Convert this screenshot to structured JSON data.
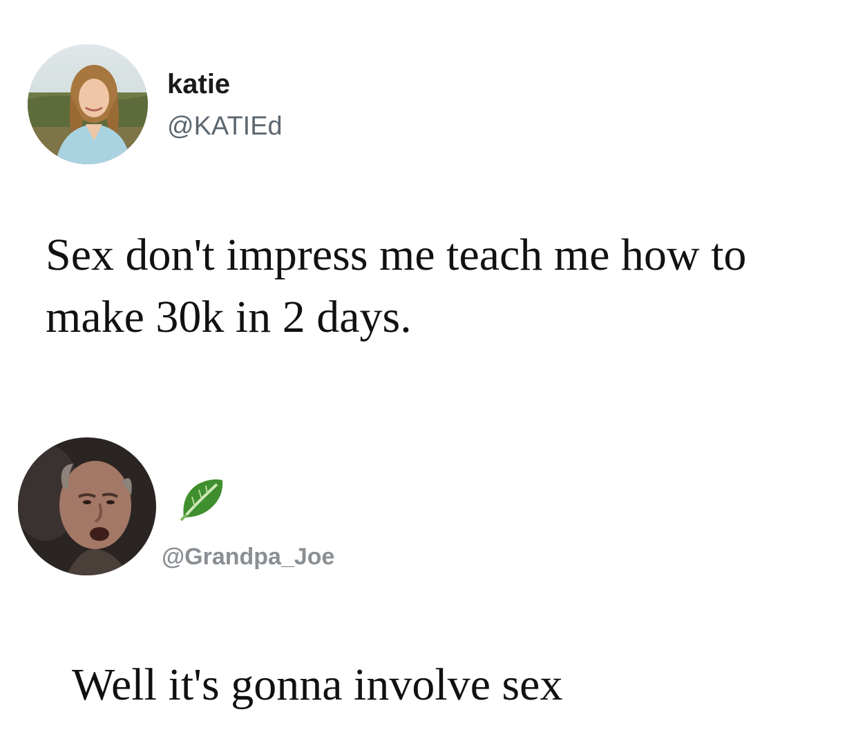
{
  "posts": [
    {
      "display_name": "katie",
      "handle": "@KATIEd",
      "text": "Sex don't impress me teach me how to make 30k in 2 days.",
      "avatar_icon": "profile-photo-woman"
    },
    {
      "handle": "@Grandpa_Joe",
      "badge_icon": "leafy-green-icon",
      "text": "Well it's gonna involve sex",
      "avatar_icon": "profile-photo-old-man"
    }
  ],
  "colors": {
    "background": "#ffffff",
    "text": "#111111",
    "handle_gray": "#5b6670",
    "handle_light_gray": "#8a8f94",
    "leaf_green": "#3f8f2e"
  }
}
